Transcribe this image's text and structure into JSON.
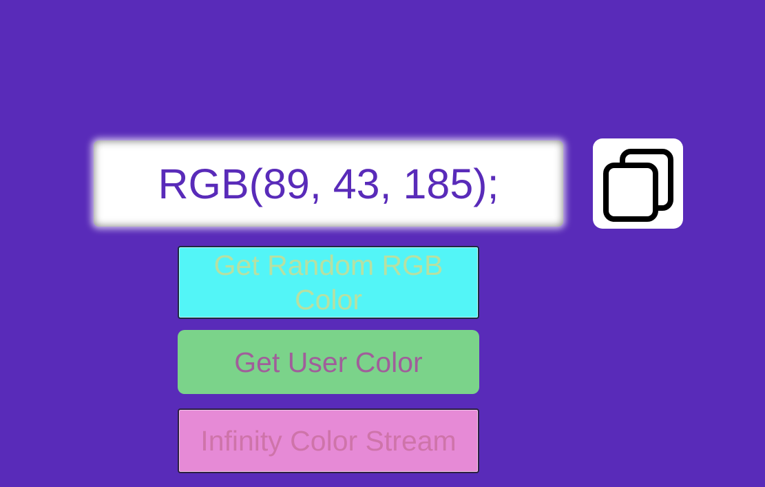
{
  "display": {
    "color_value": "RGB(89, 43, 185);"
  },
  "copy": {
    "icon": "copy-icon"
  },
  "buttons": {
    "random_label": "Get Random RGB Color",
    "user_label": "Get User Color",
    "stream_label": "Infinity Color Stream"
  },
  "colors": {
    "background": "#592bb9",
    "display_text": "#592bb9",
    "random_bg": "#53f5f7",
    "user_bg": "#7bd38a",
    "stream_bg": "#e68ad6"
  }
}
